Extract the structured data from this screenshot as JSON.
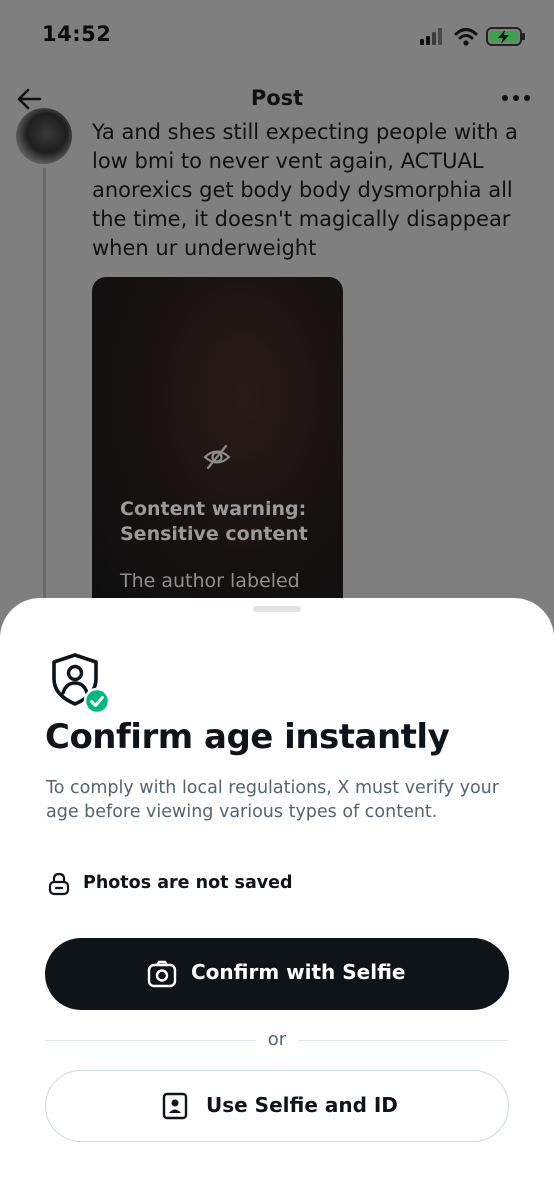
{
  "status_bar": {
    "time": "14:52",
    "icons": [
      "signal-icon",
      "wifi-icon",
      "battery-charging-icon"
    ]
  },
  "nav": {
    "title": "Post",
    "back_icon": "arrow-left-icon",
    "more_icon": "more-horizontal-icon"
  },
  "post": {
    "text_lines": [
      "Ya and shes still expecting people with a",
      "low bmi to never vent again, ACTUAL",
      "anorexics get body body dysmorphia all",
      "the time, it doesn't magically disappear",
      "when ur underweight"
    ],
    "media": {
      "icon": "eye-off-icon",
      "warning_line1": "Content warning:",
      "warning_line2": "Sensitive content",
      "description": "The author labeled"
    }
  },
  "sheet": {
    "icon": "shield-verified-icon",
    "title": "Confirm age instantly",
    "description": "To comply with local regulations, X must verify your age before viewing various types of content.",
    "privacy_note": "Photos are not saved",
    "primary_button": "Confirm with Selfie",
    "separator": "or",
    "secondary_button": "Use Selfie and ID"
  },
  "colors": {
    "overlay": "#7f7f7f",
    "primary_button_bg": "#0f1419",
    "verified_green": "#00ba7c",
    "secondary_text": "#536471",
    "border": "#cfd9de"
  }
}
